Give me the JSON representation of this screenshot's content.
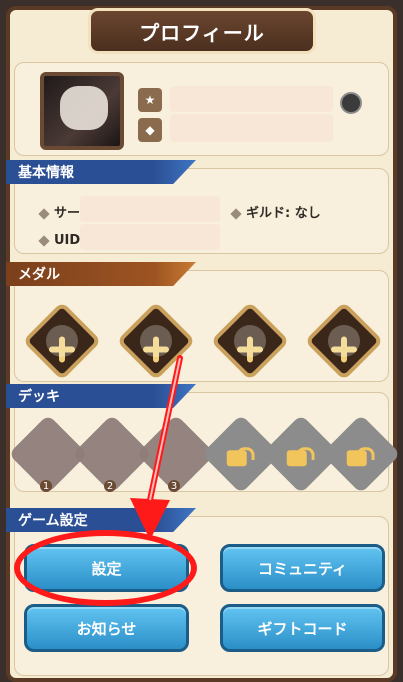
{
  "header": {
    "title": "プロフィール"
  },
  "sections": {
    "basic_info": "基本情報",
    "medal": "メダル",
    "deck": "デッキ",
    "game_settings": "ゲーム設定"
  },
  "basic_info": {
    "server_label": "サー",
    "uid_label": "UID",
    "guild_label": "ギルド:",
    "guild_value": "なし"
  },
  "deck": {
    "card_levels": [
      "1",
      "2",
      "3"
    ]
  },
  "buttons": {
    "settings": "設定",
    "community": "コミュニティ",
    "notices": "お知らせ",
    "gift_code": "ギフトコード"
  },
  "colors": {
    "accent_blue": "#2b8fc8",
    "highlight_red": "#ff1a1a",
    "panel_bg": "#f6ecd4"
  },
  "icons": {
    "edit": "edit-icon",
    "plus": "plus-icon",
    "lock": "lock-icon"
  }
}
